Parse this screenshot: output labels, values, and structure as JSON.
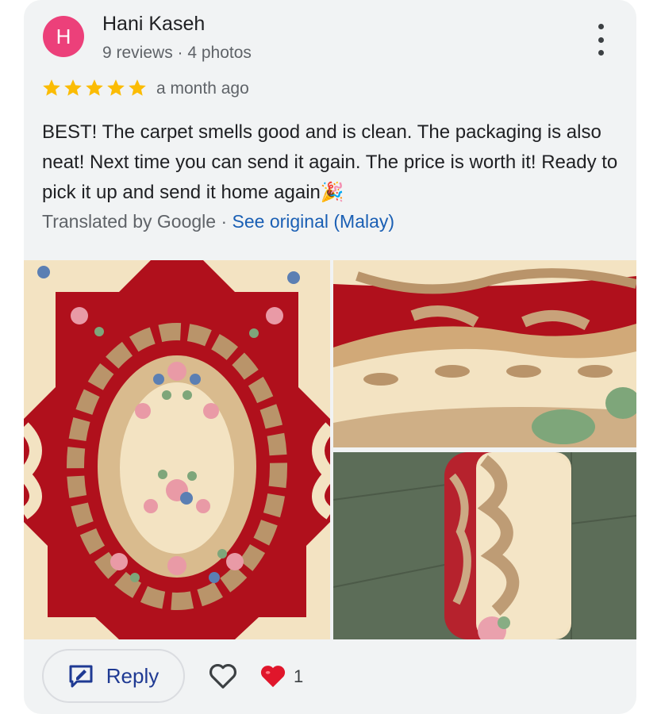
{
  "reviewer": {
    "initial": "H",
    "name": "Hani Kaseh",
    "meta": "9 reviews · 4 photos",
    "avatar_color": "#ec407a"
  },
  "rating": {
    "stars": 5,
    "max": 5,
    "color": "#fbbc04"
  },
  "time": "a month ago",
  "review_text": "BEST! The carpet smells good and is clean. The packaging is also neat! Next time you can send it again. The price is worth it! Ready to pick it up and send it home again🎉",
  "translation": {
    "label": "Translated by Google",
    "separator": "·",
    "link": "See original (Malay)"
  },
  "photos": [
    {
      "icon": "carpet-photo-full"
    },
    {
      "icon": "carpet-photo-closeup"
    },
    {
      "icon": "carpet-photo-rolled"
    }
  ],
  "actions": {
    "reply_label": "Reply",
    "like_icon": "heart-outline-icon",
    "reaction_icon": "red-heart-icon",
    "reaction_count": "1"
  },
  "colors": {
    "carpet_red": "#b0101c",
    "carpet_cream": "#f3e3c2",
    "carpet_tan": "#b9946a",
    "link_blue": "#1a5fb4"
  }
}
